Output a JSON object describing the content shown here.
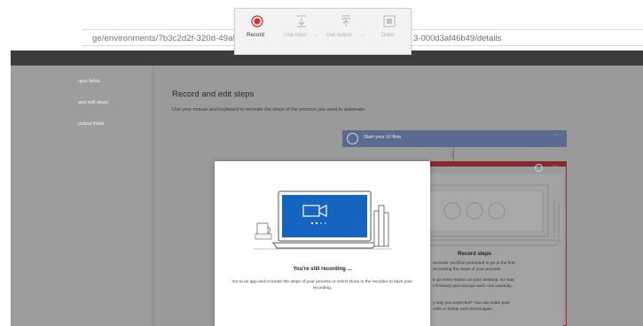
{
  "browser": {
    "address_start": "ge/environments/7b3c2d2f-320d-49a5-8",
    "address_end": "3-000d3af46b49/details"
  },
  "recorder": {
    "record_label": "Record",
    "use_input_label": "Use input",
    "get_output_label": "Get output",
    "done_label": "Done"
  },
  "sidebar": {
    "items": [
      "nput fields",
      "and edit steps",
      "output fields"
    ]
  },
  "main": {
    "title": "Record and edit steps",
    "description": "Use your mouse and keyboard to recreate the steps of the process you want to automate.",
    "start_card_label": "Start your UI flow",
    "more_glyph": "···"
  },
  "record_panel": {
    "title": "Record steps",
    "lines": [
      "recorder you'll be prompted to go to the first",
      "recreating the steps of your process.",
      "k up every motion on your desktop, so map",
      "u'll share) and execute each one carefully.",
      "y way you expected? You can make post",
      "cells or delete and record again."
    ]
  },
  "popup": {
    "title": "You're still recording ...",
    "body": "Go to an app and recreate the steps of your process or select Done in the recorder to save your recording."
  },
  "colors": {
    "record_red": "#d13438",
    "accent_blue": "#0f6cbd",
    "dark_header": "#3d3d3d"
  }
}
